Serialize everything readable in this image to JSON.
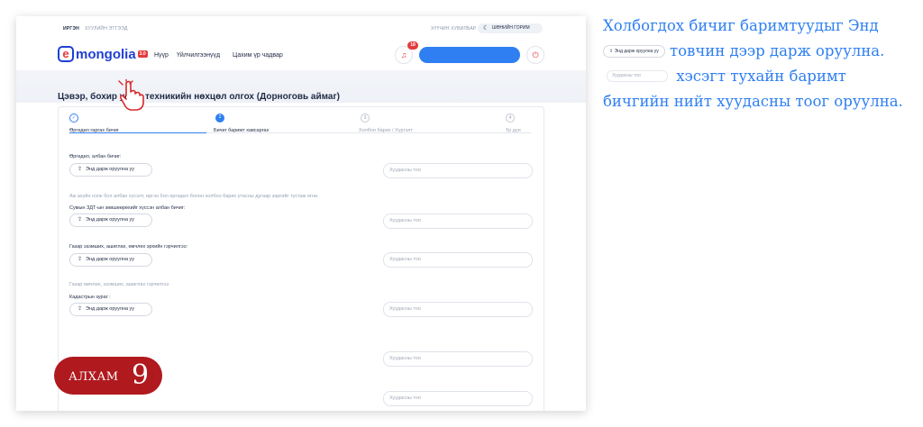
{
  "topbar": {
    "tab_citizen": "ИРГЭН",
    "tab_org": "ХУУЛИЙН ЭТГЭЭД",
    "guide": "ХҮҮЧИН ХУВИЛБАР",
    "dark_mode": "ШӨНИЙН ГОРИМ"
  },
  "header": {
    "logo_letter": "e",
    "logo_text": "mongolia",
    "logo_version": "3.0",
    "nav": [
      "Нүүр",
      "Үйлчилгээнүүд",
      "Цахим үр чадвар"
    ],
    "notification_count": "18"
  },
  "page_title": "Цэвэр, бохир усны техникийн нөхцөл олгох (Дорноговь аймаг)",
  "steps": [
    {
      "number": "✓",
      "label": "Өргөдөл гаргах бичиг",
      "state": "done"
    },
    {
      "number": "2",
      "label": "Бичиг баримт хавсаргах",
      "state": "active"
    },
    {
      "number": "3",
      "label": "Холбоо барих / Хүргэлт",
      "state": "pending"
    },
    {
      "number": "4",
      "label": "Үр дүн",
      "state": "pending"
    }
  ],
  "form": {
    "upload_label": "Энд дарж оруулна уу",
    "pages_placeholder": "Хуудасны тоо",
    "fields": [
      {
        "label": "Өргөдөл, албан бичиг:"
      },
      {
        "hint": "Аж ахуйн нэгж бол албан хүсэлт, иргэн бол өргөдөл болон холбоо барих утасны дугаар заргийг тустаж өгнө.",
        "label": "Сумын ЗДТ-ын зөвшөөрөхийг хүссэн албан бичиг:"
      },
      {
        "label": "Газар эзэмших, ашиглах, өмчлөх эрхийн гэрчилгээ:"
      },
      {
        "hint": "Газар өмчлөх, эзэмших, ашиглах гэрчилгээ",
        "label": "Кадастрын зураг :"
      }
    ]
  },
  "step_badge": {
    "word": "АЛХАМ",
    "number": "9"
  },
  "instructions": {
    "part1": "Холбогдох бичиг баримтуудыг Энд",
    "part2": "товчин дээр дарж оруулна.",
    "part3": "хэсэгт тухайн баримт бичгийн нийт хуудасны тоог оруулна."
  }
}
